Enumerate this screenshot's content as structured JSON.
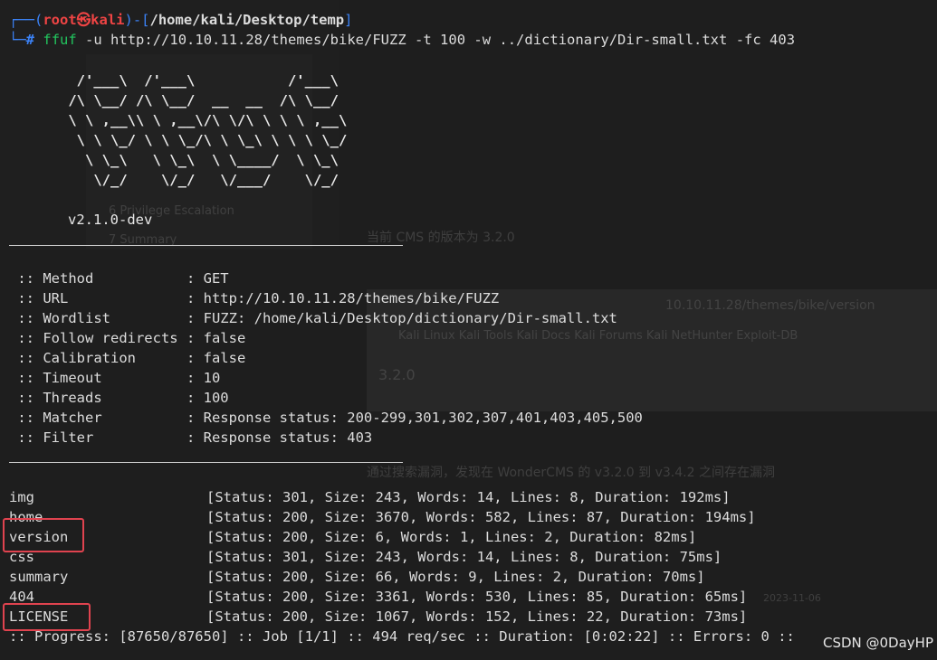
{
  "prompt": {
    "user": "root",
    "at_symbol": "㉿",
    "host": "kali",
    "cwd": "/home/kali/Desktop/temp",
    "hash": "#",
    "command": "ffuf",
    "arg_u_flag": "-u",
    "arg_u_val": "http://10.10.11.28/themes/bike/FUZZ",
    "arg_t_flag": "-t",
    "arg_t_val": "100",
    "arg_w_flag": "-w",
    "arg_w_val": "../dictionary/Dir-small.txt",
    "arg_fc_flag": "-fc",
    "arg_fc_val": "403"
  },
  "banner": {
    "ascii": "        /'___\\  /'___\\           /'___\\\n       /\\ \\__/ /\\ \\__/  __  __  /\\ \\__/\n       \\ \\ ,__\\\\ \\ ,__\\/\\ \\/\\ \\ \\ \\ ,__\\\n        \\ \\ \\_/ \\ \\ \\_/\\ \\ \\_\\ \\ \\ \\ \\_/\n         \\ \\_\\   \\ \\_\\  \\ \\____/  \\ \\_\\\n          \\/_/    \\/_/   \\/___/    \\/_/",
    "version": "v2.1.0-dev"
  },
  "config": [
    {
      "key": " :: Method           ",
      "val": ": GET"
    },
    {
      "key": " :: URL              ",
      "val": ": http://10.10.11.28/themes/bike/FUZZ"
    },
    {
      "key": " :: Wordlist         ",
      "val": ": FUZZ: /home/kali/Desktop/dictionary/Dir-small.txt"
    },
    {
      "key": " :: Follow redirects ",
      "val": ": false"
    },
    {
      "key": " :: Calibration      ",
      "val": ": false"
    },
    {
      "key": " :: Timeout          ",
      "val": ": 10"
    },
    {
      "key": " :: Threads          ",
      "val": ": 100"
    },
    {
      "key": " :: Matcher          ",
      "val": ": Response status: 200-299,301,302,307,401,403,405,500"
    },
    {
      "key": " :: Filter           ",
      "val": ": Response status: 403"
    }
  ],
  "results": [
    {
      "name": "img",
      "info": "[Status: 301, Size: 243, Words: 14, Lines: 8, Duration: 192ms]"
    },
    {
      "name": "home",
      "info": "[Status: 200, Size: 3670, Words: 582, Lines: 87, Duration: 194ms]"
    },
    {
      "name": "version",
      "info": "[Status: 200, Size: 6, Words: 1, Lines: 2, Duration: 82ms]"
    },
    {
      "name": "css",
      "info": "[Status: 301, Size: 243, Words: 14, Lines: 8, Duration: 75ms]"
    },
    {
      "name": "summary",
      "info": "[Status: 200, Size: 66, Words: 9, Lines: 2, Duration: 70ms]"
    },
    {
      "name": "404",
      "info": "[Status: 200, Size: 3361, Words: 530, Lines: 85, Duration: 65ms]"
    },
    {
      "name": "LICENSE",
      "info": "[Status: 200, Size: 1067, Words: 152, Lines: 22, Duration: 73ms]"
    }
  ],
  "progress": ":: Progress: [87650/87650] :: Job [1/1] :: 494 req/sec :: Duration: [0:02:22] :: Errors: 0 ::",
  "watermark": "CSDN @0DayHP",
  "background": {
    "summary": "7 Summary",
    "privesc": "6 Privilege Escalation",
    "cms_version": "当前 CMS 的版本为 3.2.0",
    "url_bar": "10.10.11.28/themes/bike/version",
    "bookmarks": "Kali Linux    Kali Tools    Kali Docs    Kali Forums    Kali NetHunter    Exploit-DB",
    "version_text": "3.2.0",
    "vuln_note": "通过搜索漏洞，发现在 WonderCMS 的 v3.2.0 到 v3.4.2 之间存在漏洞",
    "date": "2023-11-06"
  },
  "colors": {
    "highlight": "#e0434f",
    "prompt_bracket": "#3b82f6",
    "root_user": "#ef4444",
    "command": "#22c55e"
  }
}
